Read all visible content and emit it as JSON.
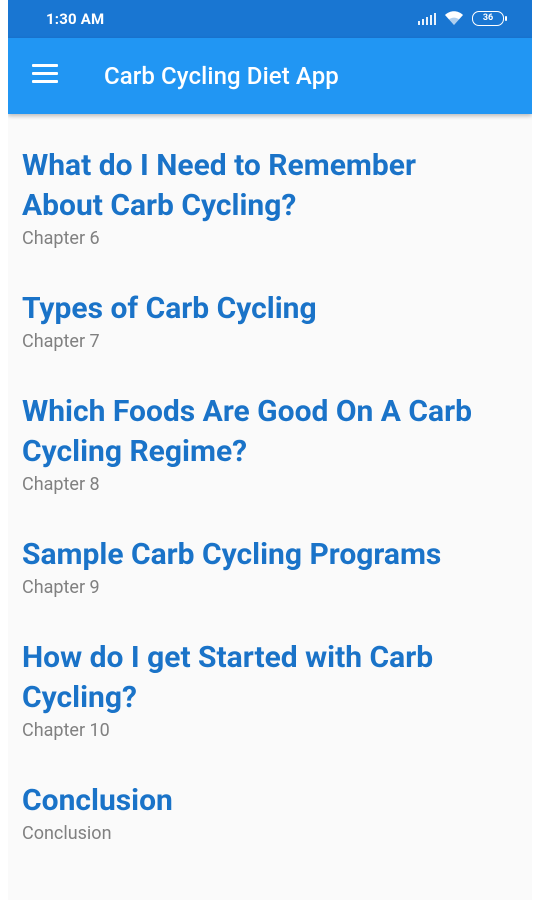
{
  "status_bar": {
    "time": "1:30 AM",
    "battery": "36"
  },
  "app_bar": {
    "menu_icon": "hamburger-menu-icon",
    "title": "Carb Cycling Diet App"
  },
  "chapters": [
    {
      "title": "What do I Need to Remember About Carb Cycling?",
      "subtitle": "Chapter 6"
    },
    {
      "title": "Types of Carb Cycling",
      "subtitle": "Chapter 7"
    },
    {
      "title": "Which Foods Are Good On A Carb Cycling Regime?",
      "subtitle": "Chapter 8"
    },
    {
      "title": "Sample Carb Cycling Programs",
      "subtitle": "Chapter 9"
    },
    {
      "title": "How do I get Started with Carb Cycling?",
      "subtitle": "Chapter 10"
    },
    {
      "title": "Conclusion",
      "subtitle": "Conclusion"
    }
  ],
  "colors": {
    "status_bar": "#1976d2",
    "app_bar": "#2196f3",
    "chapter_title": "#1a73c8",
    "chapter_subtitle": "#808080"
  }
}
